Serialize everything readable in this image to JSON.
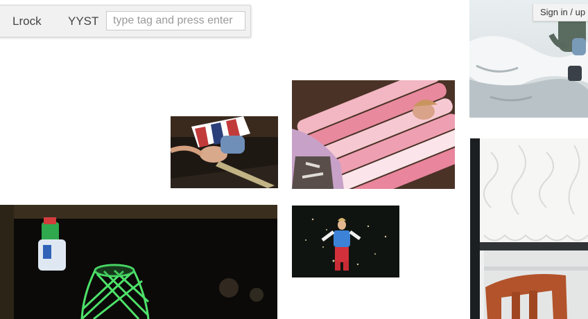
{
  "toolbar": {
    "tags": [
      "Lrock",
      "YYST"
    ],
    "input_placeholder": "type tag and press enter",
    "input_value": ""
  },
  "auth": {
    "label": "Sign in / up"
  },
  "photos": [
    {
      "icon": "snow-child-photo"
    },
    {
      "icon": "striped-shirt-photo"
    },
    {
      "icon": "pink-pillows-photo"
    },
    {
      "icon": "green-vase-photo"
    },
    {
      "icon": "dancing-girl-photo"
    },
    {
      "icon": "lace-curtain-photo"
    }
  ]
}
